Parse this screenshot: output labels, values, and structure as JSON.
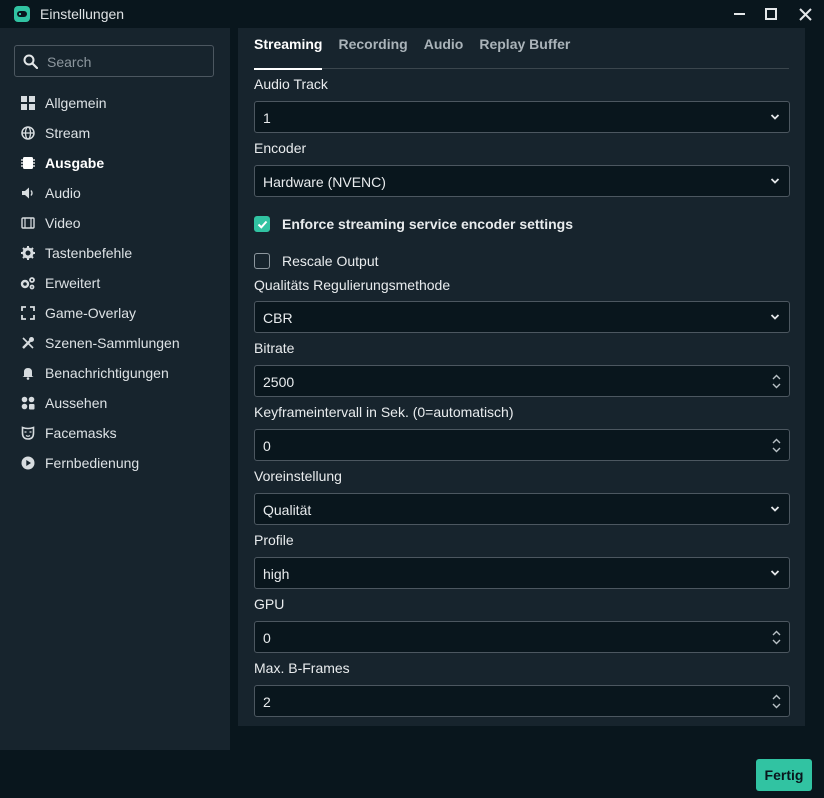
{
  "window": {
    "title": "Einstellungen",
    "icons": {
      "app": "streamlabs-logo-icon",
      "minimize": "minimize-icon",
      "maximize": "maximize-icon",
      "close": "close-icon"
    }
  },
  "sidebar": {
    "search": {
      "placeholder": "Search",
      "value": "",
      "icon": "search-icon"
    },
    "items": [
      {
        "label": "Allgemein",
        "icon": "grid-icon",
        "active": false
      },
      {
        "label": "Stream",
        "icon": "globe-icon",
        "active": false
      },
      {
        "label": "Ausgabe",
        "icon": "output-icon",
        "active": true
      },
      {
        "label": "Audio",
        "icon": "speaker-icon",
        "active": false
      },
      {
        "label": "Video",
        "icon": "film-icon",
        "active": false
      },
      {
        "label": "Tastenbefehle",
        "icon": "gear-icon",
        "active": false
      },
      {
        "label": "Erweitert",
        "icon": "gears-icon",
        "active": false
      },
      {
        "label": "Game-Overlay",
        "icon": "expand-icon",
        "active": false
      },
      {
        "label": "Szenen-Sammlungen",
        "icon": "tools-icon",
        "active": false
      },
      {
        "label": "Benachrichtigungen",
        "icon": "bell-icon",
        "active": false
      },
      {
        "label": "Aussehen",
        "icon": "palette-icon",
        "active": false
      },
      {
        "label": "Facemasks",
        "icon": "mask-icon",
        "active": false
      },
      {
        "label": "Fernbedienung",
        "icon": "play-circle-icon",
        "active": false
      }
    ]
  },
  "tabs": [
    {
      "label": "Streaming",
      "active": true
    },
    {
      "label": "Recording",
      "active": false
    },
    {
      "label": "Audio",
      "active": false
    },
    {
      "label": "Replay Buffer",
      "active": false
    }
  ],
  "fields": {
    "audio_track": {
      "label": "Audio Track",
      "value": "1"
    },
    "encoder": {
      "label": "Encoder",
      "value": "Hardware (NVENC)"
    },
    "enforce": {
      "label": "Enforce streaming service encoder settings",
      "checked": true
    },
    "rescale": {
      "label": "Rescale Output",
      "checked": false
    },
    "rate_control": {
      "label": "Qualitäts Regulierungsmethode",
      "value": "CBR"
    },
    "bitrate": {
      "label": "Bitrate",
      "value": "2500"
    },
    "keyframe": {
      "label": "Keyframeintervall in Sek. (0=automatisch)",
      "value": "0"
    },
    "preset": {
      "label": "Voreinstellung",
      "value": "Qualität"
    },
    "profile": {
      "label": "Profile",
      "value": "high"
    },
    "gpu": {
      "label": "GPU",
      "value": "0"
    },
    "bframes": {
      "label": "Max. B-Frames",
      "value": "2"
    }
  },
  "footer": {
    "done_label": "Fertig"
  },
  "colors": {
    "accent": "#31c3a2",
    "background": "#09161d",
    "panel": "#17242d"
  }
}
